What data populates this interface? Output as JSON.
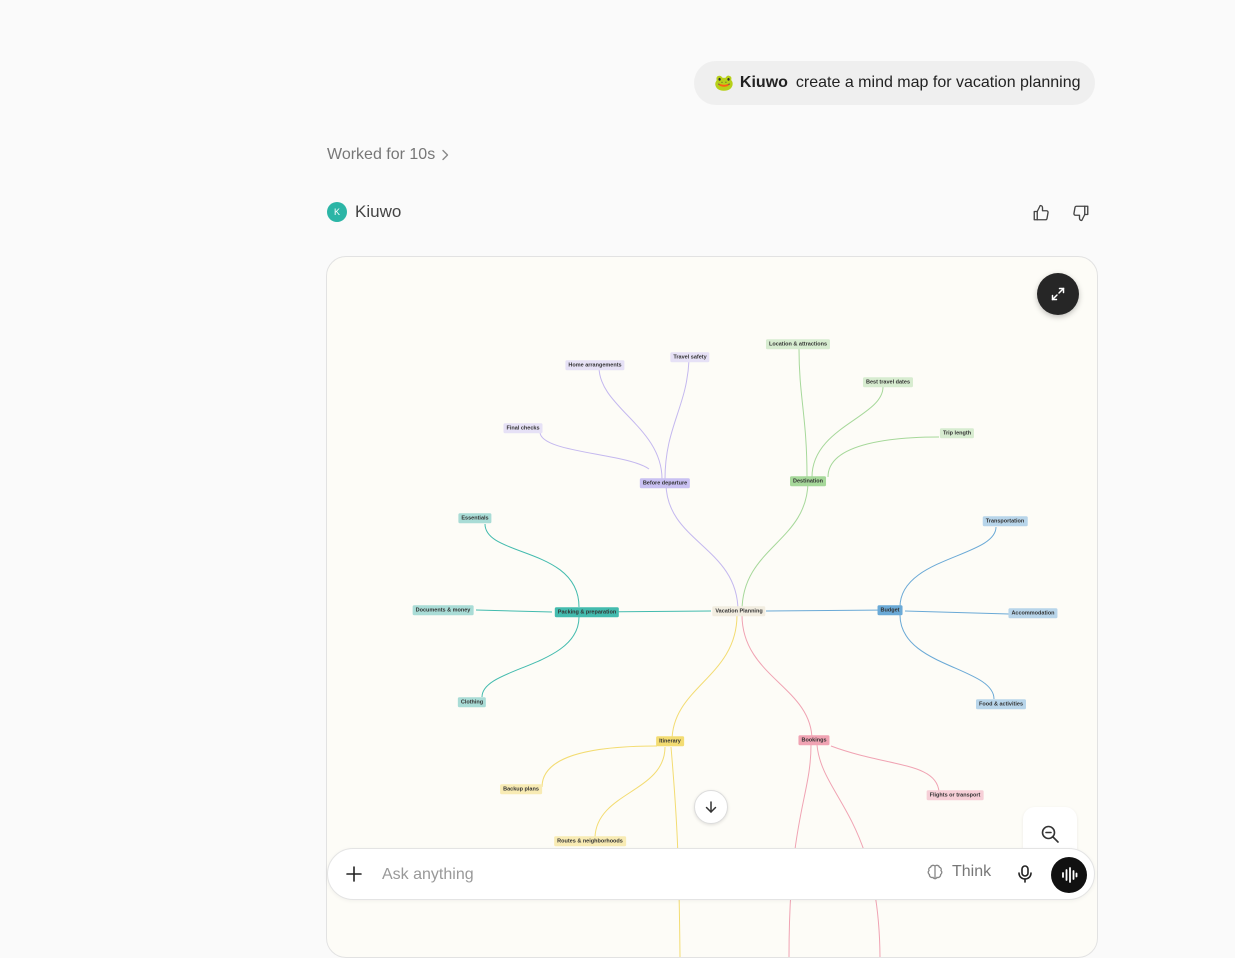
{
  "user_message": {
    "icon": "frog-emoji",
    "emoji": "🐸",
    "mention": "Kiuwo",
    "text": "create a mind map for vacation planning"
  },
  "status": {
    "worked_label": "Worked for 10s"
  },
  "assistant": {
    "avatar_letter": "K",
    "name": "Kiuwo"
  },
  "mindmap": {
    "root": "Vacation Planning",
    "branches": [
      {
        "label": "Before departure",
        "color": "#c4b8ef",
        "children": [
          "Home arrangements",
          "Travel safety",
          "Final checks"
        ]
      },
      {
        "label": "Destination",
        "color": "#a6d89a",
        "children": [
          "Location & attractions",
          "Best travel dates",
          "Trip length"
        ]
      },
      {
        "label": "Packing & preparation",
        "color": "#43bbae",
        "children": [
          "Essentials",
          "Documents & money",
          "Clothing"
        ]
      },
      {
        "label": "Budget",
        "color": "#6aa9d6",
        "children": [
          "Transportation",
          "Accommodation",
          "Food & activities"
        ]
      },
      {
        "label": "Itinerary",
        "color": "#f3dc72",
        "children": [
          "Backup plans",
          "Routes & neighborhoods"
        ]
      },
      {
        "label": "Bookings",
        "color": "#f0a3b3",
        "children": [
          "Flights or transport"
        ]
      }
    ]
  },
  "composer": {
    "placeholder": "Ask anything",
    "think_label": "Think"
  },
  "colors": {
    "accent": "#2bb5a6",
    "dark_button": "#111111"
  }
}
